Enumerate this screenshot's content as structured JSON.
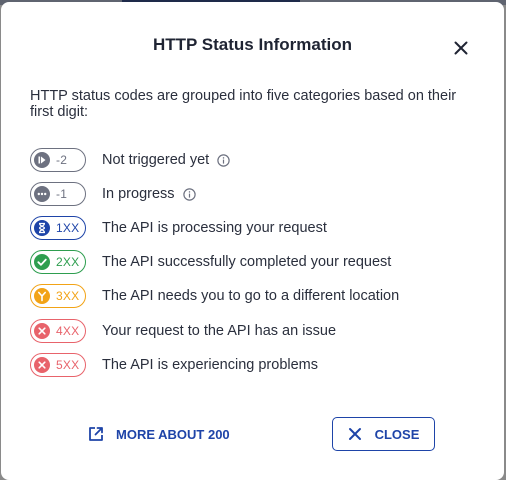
{
  "dialog": {
    "title": "HTTP Status Information",
    "intro": "HTTP status codes are grouped into five categories based on their first digit:",
    "close_icon": "close-icon"
  },
  "statuses": [
    {
      "code": "-2",
      "label": "Not triggered yet",
      "icon": "play-icon",
      "color": "#6d7180",
      "info": true
    },
    {
      "code": "-1",
      "label": "In progress",
      "icon": "more-horizontal-icon",
      "color": "#6d7180",
      "info": true
    },
    {
      "code": "1XX",
      "label": "The API is processing your request",
      "icon": "hourglass-icon",
      "color": "#1e44a8",
      "info": false
    },
    {
      "code": "2XX",
      "label": "The API successfully completed your request",
      "icon": "check-icon",
      "color": "#2e9e4f",
      "info": false
    },
    {
      "code": "3XX",
      "label": "The API needs you to go to a different location",
      "icon": "redirect-fork-icon",
      "color": "#f2a316",
      "info": false
    },
    {
      "code": "4XX",
      "label": "Your request to the API has an issue",
      "icon": "x-circle-icon",
      "color": "#e8636b",
      "info": false
    },
    {
      "code": "5XX",
      "label": "The API is experiencing problems",
      "icon": "x-circle-icon",
      "color": "#e8636b",
      "info": false
    }
  ],
  "footer": {
    "link_label": "MORE ABOUT 200",
    "link_icon": "external-link-icon",
    "close_label": "CLOSE",
    "close_icon": "close-icon"
  },
  "colors": {
    "primary": "#1e44a8",
    "text": "#2a2f3d"
  }
}
